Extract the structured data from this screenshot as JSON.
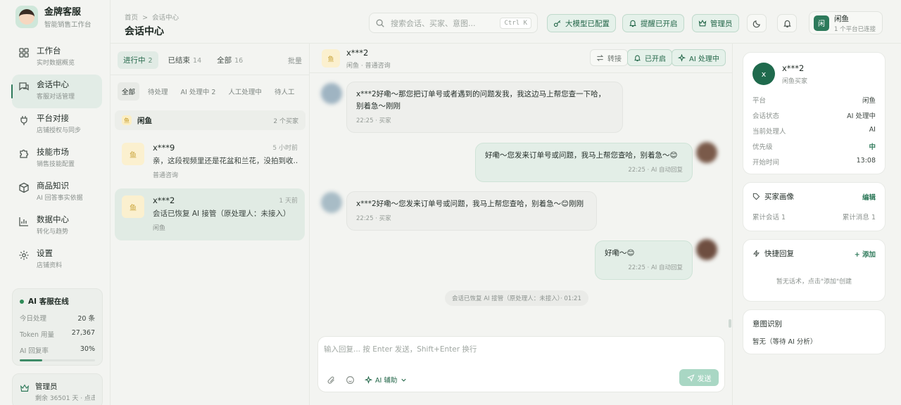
{
  "brand": {
    "title": "金牌客服",
    "subtitle": "智能销售工作台"
  },
  "nav": [
    {
      "label": "工作台",
      "sub": "实时数据概览"
    },
    {
      "label": "会话中心",
      "sub": "客服对话管理"
    },
    {
      "label": "平台对接",
      "sub": "店铺授权与同步"
    },
    {
      "label": "技能市场",
      "sub": "销售技能配置"
    },
    {
      "label": "商品知识",
      "sub": "AI 回答事实依据"
    },
    {
      "label": "数据中心",
      "sub": "转化与趋势"
    },
    {
      "label": "设置",
      "sub": "店铺资料"
    }
  ],
  "ai_status": {
    "title": "AI 客服在线",
    "rows": [
      {
        "label": "今日处理",
        "value": "20 条"
      },
      {
        "label": "Token 用量",
        "value": "27,367"
      },
      {
        "label": "AI 回复率",
        "value": "30%"
      }
    ],
    "reply_rate": 0.3
  },
  "admin": {
    "name": "管理员",
    "sub": "剩余 36501 天 · 点击"
  },
  "topbar": {
    "crumb_home": "首页",
    "crumb_sep": ">",
    "crumb_current": "会话中心",
    "title": "会话中心",
    "search_placeholder": "搜索会话、买家、意图...",
    "search_kbd": "Ctrl K",
    "llm_btn": "大模型已配置",
    "remind_btn": "提醒已开启",
    "admin_btn": "管理员",
    "user_avatar": "闲",
    "user_name": "闲鱼",
    "user_sub": "1 个平台已连接"
  },
  "list": {
    "tabs": [
      {
        "label": "进行中",
        "count": "2"
      },
      {
        "label": "已结束",
        "count": "14"
      },
      {
        "label": "全部",
        "count": "16"
      }
    ],
    "bulk": "批量",
    "subtabs": [
      "全部",
      "待处理",
      "AI 处理中 2",
      "人工处理中",
      "待人工"
    ],
    "group": {
      "icon": "鱼",
      "name": "闲鱼",
      "count": "2 个买家"
    },
    "conversations": [
      {
        "avatar": "鱼",
        "name": "x***9",
        "time": "5 小时前",
        "msg": "亲，这段视频里还是花盆和兰花，没拍到收...",
        "tag": "普通咨询"
      },
      {
        "avatar": "鱼",
        "name": "x***2",
        "time": "1 天前",
        "msg": "会话已恢复 AI 接管（原处理人：未接入）",
        "tag": "闲鱼"
      }
    ]
  },
  "chat": {
    "avatar": "鱼",
    "name": "x***2",
    "sub": "闲鱼 · 普通咨询",
    "transfer_btn": "转接",
    "on_btn": "已开启",
    "ai_btn": "AI 处理中",
    "messages": [
      {
        "dir": "in",
        "lines": [
          "x***2好嘞～那您把订单号或者遇到的问题发我，我这边马上帮您查一下哈，",
          "别着急～刚刚"
        ],
        "meta": "22:25 · 买家"
      },
      {
        "dir": "out",
        "lines": [
          "好嘞～您发来订单号或问题，我马上帮您查哈，别着急～😊"
        ],
        "meta": "22:25 · AI 自动回复"
      },
      {
        "dir": "in",
        "lines": [
          "x***2好嘞～您发来订单号或问题，我马上帮您查哈，别着急～😊刚刚"
        ],
        "meta": "22:25 · 买家"
      },
      {
        "dir": "out",
        "lines": [
          "好嘞～😊"
        ],
        "meta": "22:25 · AI 自动回复"
      }
    ],
    "system": "会话已恢复 AI 接管（原处理人：未接入）· 01:21",
    "composer_placeholder": "输入回复... 按 Enter 发送，Shift+Enter 换行",
    "ai_assist": "AI 辅助",
    "send": "发送"
  },
  "profile": {
    "avatar": "x",
    "name": "x***2",
    "sub": "闲鱼买家",
    "rows": [
      {
        "label": "平台",
        "value": "闲鱼"
      },
      {
        "label": "会话状态",
        "value": "AI 处理中"
      },
      {
        "label": "当前处理人",
        "value": "AI"
      },
      {
        "label": "优先级",
        "value": "中"
      },
      {
        "label": "开始时间",
        "value": "13:08"
      }
    ]
  },
  "buyer_portrait": {
    "title": "买家画像",
    "edit": "编辑",
    "total_sessions": "累计会话 1",
    "total_messages": "累计消息 1"
  },
  "quick_reply": {
    "title": "快捷回复",
    "add": "+ 添加",
    "empty": "暂无话术，点击\"添加\"创建"
  },
  "intent": {
    "title": "意图识别",
    "value": "暂无（等待 AI 分析）"
  },
  "colors": {
    "accent": "#2f7a5b",
    "accent_bg": "#e5f1ea",
    "page_bg": "#f3f4f1"
  }
}
